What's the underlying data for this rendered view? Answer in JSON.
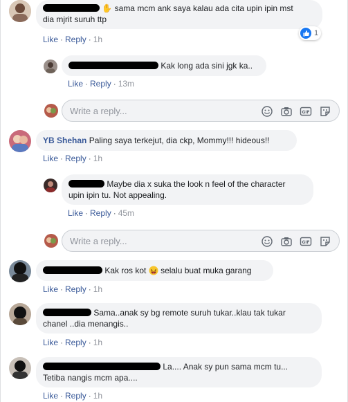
{
  "colors": {
    "link": "#385898",
    "bubble": "#f2f3f5",
    "like_blue": "#1877f2"
  },
  "actions": {
    "like": "Like",
    "reply": "Reply",
    "separator": "·"
  },
  "reply_placeholder": "Write a reply...",
  "comments": [
    {
      "text_line1": "sama mcm ank saya kalau ada cita upin ipin mst",
      "text_line2": "dia mjrit suruh ttp",
      "time": "1h",
      "reaction_count": "1"
    },
    {
      "text": "Kak long ada sini jgk ka..",
      "time": "13m"
    },
    {
      "author": "YB Shehan",
      "text": "Paling saya terkejut, dia ckp, Mommy!!! hideous!!",
      "time": "1h"
    },
    {
      "text_line1": "Maybe dia x suka the look n feel of the character",
      "text_line2": "upin ipin tu. Not appealing.",
      "time": "45m"
    },
    {
      "text_before": "Kak ros kot",
      "text_after": "selalu buat muka garang",
      "time": "1h"
    },
    {
      "text_line1": "Sama..anak sy bg remote suruh tukar..klau tak tukar",
      "text_line2": "chanel ..dia menangis..",
      "time": "1h"
    },
    {
      "text_line1": "La.... Anak sy pun sama mcm tu...",
      "text_line2": "Tetiba nangis mcm apa....",
      "time": "1h"
    }
  ],
  "icons": [
    "emoji-icon",
    "camera-icon",
    "gif-icon",
    "sticker-icon",
    "like-thumb-icon",
    "laughing-emoji-icon",
    "wave-hand-icon"
  ]
}
